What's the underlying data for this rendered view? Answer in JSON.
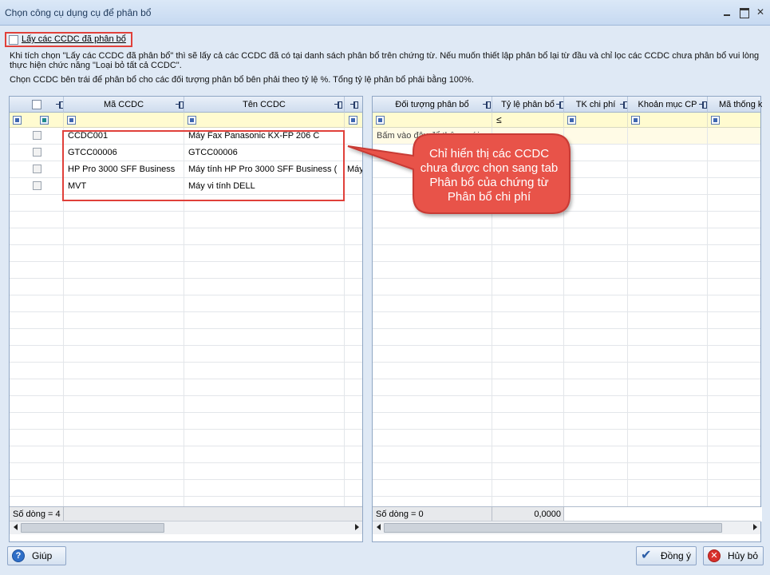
{
  "window": {
    "title": "Chọn công cụ dụng cụ để phân bổ"
  },
  "option": {
    "label": "Lấy các CCDC đã phân bổ",
    "checked": false
  },
  "info": {
    "line1": "Khi tích chọn \"Lấy các CCDC đã phân bổ\" thì sẽ lấy cả các CCDC đã có tại danh sách phân bổ trên chứng từ. Nếu muốn thiết lập phân bổ lại từ đầu và chỉ lọc các CCDC chưa phân bổ vui lòng thực hiện chức năng \"Loại bỏ tất cả CCDC\".",
    "line2": "Chọn CCDC bên trái để phân bổ cho các đối tượng phân bổ bên phải theo tỷ lệ %. Tổng tỷ lệ phân bổ phải bằng 100%."
  },
  "left_grid": {
    "headers": [
      "Mã CCDC",
      "Tên CCDC"
    ],
    "rows": [
      {
        "code": "CCDC001",
        "name": "Máy Fax Panasonic KX-FP 206 C",
        "extra": ""
      },
      {
        "code": "GTCC00006",
        "name": "GTCC00006",
        "extra": ""
      },
      {
        "code": "HP Pro 3000 SFF Business",
        "name": "Máy tính HP Pro 3000 SFF Business (",
        "extra": "Máy"
      },
      {
        "code": "MVT",
        "name": "Máy vi tính DELL",
        "extra": ""
      }
    ],
    "footer": "Số dòng = 4"
  },
  "right_grid": {
    "headers": [
      "Đối tượng phân bổ",
      "Tỷ lệ phân bổ",
      "TK chi phí",
      "Khoản mục CP",
      "Mã thống k"
    ],
    "filter_op": "≤",
    "first_row_text": "Bấm vào đây để thêm mới",
    "footer_count": "Số dòng = 0",
    "footer_total": "0,0000"
  },
  "callout": {
    "text": "Chỉ hiển thị các CCDC chưa được chọn sang tab Phân bổ của chứng từ Phân bổ chi phí"
  },
  "buttons": {
    "help": "Giúp",
    "ok": "Đồng ý",
    "cancel": "Hủy bỏ"
  }
}
